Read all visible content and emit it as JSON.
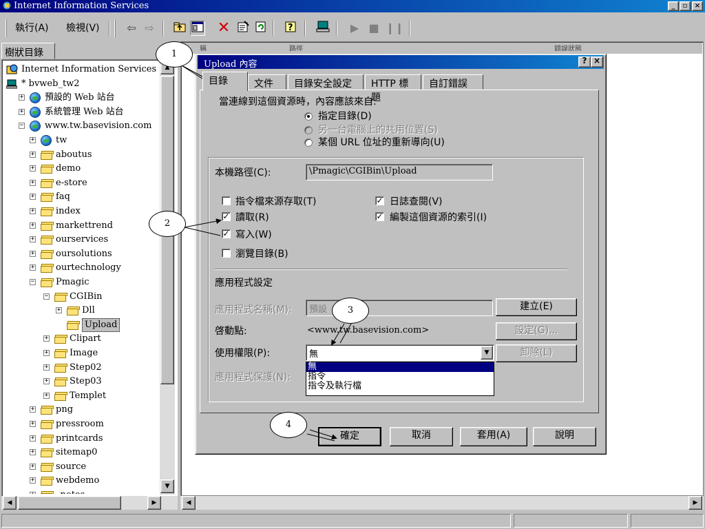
{
  "window": {
    "title": "Internet Information Services",
    "min": "_",
    "max": "▫",
    "close": "×"
  },
  "menu": {
    "action": "執行(A)",
    "view": "檢視(V)"
  },
  "toolbar_icons": [
    "back-icon",
    "forward-icon",
    "up-folder-icon",
    "show-hide-tree-icon",
    "delete-icon",
    "properties-icon",
    "refresh-icon",
    "help-icon",
    "computer-icon",
    "play-icon",
    "stop-icon",
    "pause-icon"
  ],
  "tree": {
    "tab_label": "樹狀目錄",
    "items": [
      {
        "label": "Internet Information Services",
        "icon": "iis-icon",
        "level": 0,
        "expander": ""
      },
      {
        "label": "* bvweb_tw2",
        "icon": "computer-icon",
        "level": 0,
        "expander": "−"
      },
      {
        "label": "預設的 Web 站台",
        "icon": "web-site-icon",
        "level": 1,
        "expander": "+"
      },
      {
        "label": "系統管理 Web 站台",
        "icon": "web-site-icon",
        "level": 1,
        "expander": "+"
      },
      {
        "label": "www.tw.basevision.com",
        "icon": "web-site-icon",
        "level": 1,
        "expander": "−"
      },
      {
        "label": "tw",
        "icon": "globe-icon",
        "level": 2,
        "expander": "+"
      },
      {
        "label": "aboutus",
        "icon": "folder-icon",
        "level": 2,
        "expander": "+"
      },
      {
        "label": "demo",
        "icon": "folder-icon",
        "level": 2,
        "expander": "+"
      },
      {
        "label": "e-store",
        "icon": "folder-icon",
        "level": 2,
        "expander": "+"
      },
      {
        "label": "faq",
        "icon": "folder-icon",
        "level": 2,
        "expander": "+"
      },
      {
        "label": "index",
        "icon": "folder-icon",
        "level": 2,
        "expander": "+"
      },
      {
        "label": "markettrend",
        "icon": "folder-icon",
        "level": 2,
        "expander": "+"
      },
      {
        "label": "ourservices",
        "icon": "folder-icon",
        "level": 2,
        "expander": "+"
      },
      {
        "label": "oursolutions",
        "icon": "folder-icon",
        "level": 2,
        "expander": "+"
      },
      {
        "label": "ourtechnology",
        "icon": "folder-icon",
        "level": 2,
        "expander": "+"
      },
      {
        "label": "Pmagic",
        "icon": "folder-icon",
        "level": 2,
        "expander": "−"
      },
      {
        "label": "CGIBin",
        "icon": "folder-icon",
        "level": 3,
        "expander": "−"
      },
      {
        "label": "Dll",
        "icon": "folder-icon",
        "level": 4,
        "expander": "+"
      },
      {
        "label": "Upload",
        "icon": "folder-icon",
        "level": 4,
        "expander": "",
        "selected": true
      },
      {
        "label": "Clipart",
        "icon": "folder-icon",
        "level": 3,
        "expander": "+"
      },
      {
        "label": "Image",
        "icon": "folder-icon",
        "level": 3,
        "expander": "+"
      },
      {
        "label": "Step02",
        "icon": "folder-icon",
        "level": 3,
        "expander": "+"
      },
      {
        "label": "Step03",
        "icon": "folder-icon",
        "level": 3,
        "expander": "+"
      },
      {
        "label": "Templet",
        "icon": "folder-icon",
        "level": 3,
        "expander": "+"
      },
      {
        "label": "png",
        "icon": "folder-icon",
        "level": 2,
        "expander": "+"
      },
      {
        "label": "pressroom",
        "icon": "folder-icon",
        "level": 2,
        "expander": "+"
      },
      {
        "label": "printcards",
        "icon": "folder-icon",
        "level": 2,
        "expander": "+"
      },
      {
        "label": "sitemap0",
        "icon": "folder-icon",
        "level": 2,
        "expander": "+"
      },
      {
        "label": "source",
        "icon": "folder-icon",
        "level": 2,
        "expander": "+"
      },
      {
        "label": "webdemo",
        "icon": "folder-icon",
        "level": 2,
        "expander": "+"
      },
      {
        "label": "_notes",
        "icon": "folder-icon",
        "level": 2,
        "expander": "+"
      }
    ]
  },
  "list_headers": [
    "稱",
    "路徑",
    "錯誤狀態"
  ],
  "dialog": {
    "title": "Upload 內容",
    "help_btn": "?",
    "close_btn": "×",
    "tabs": [
      "目錄",
      "文件",
      "目錄安全設定",
      "HTTP 標題",
      "自訂錯誤"
    ],
    "source_prompt": "當連線到這個資源時，內容應該來自:",
    "radios": [
      {
        "label": "指定目錄(D)",
        "checked": true,
        "disabled": false
      },
      {
        "label": "另一台電腦上的共用位置(S)",
        "checked": false,
        "disabled": true
      },
      {
        "label": "某個 URL 位址的重新導向(U)",
        "checked": false,
        "disabled": false
      }
    ],
    "local_path_label": "本機路徑(C):",
    "local_path_value": "\\Pmagic\\CGIBin\\Upload",
    "checkboxes_left": [
      {
        "label": "指令檔來源存取(T)",
        "checked": false
      },
      {
        "label": "讀取(R)",
        "checked": true
      },
      {
        "label": "寫入(W)",
        "checked": true
      },
      {
        "label": "瀏覽目錄(B)",
        "checked": false
      }
    ],
    "checkboxes_right": [
      {
        "label": "日誌查閱(V)",
        "checked": true
      },
      {
        "label": "編製這個資源的索引(I)",
        "checked": true
      }
    ],
    "app_settings_title": "應用程式設定",
    "app_name_label": "應用程式名稱(M):",
    "app_name_value": "預設",
    "create_btn": "建立(E)",
    "start_point_label": "啓動點:",
    "start_point_value": "<www.tw.basevision.com>",
    "config_btn": "設定(G)...",
    "permission_label": "使用權限(P):",
    "permission_value": "無",
    "unload_btn": "卸除(L)",
    "app_protection_label": "應用程式保護(N):",
    "permission_options": [
      "無",
      "指令",
      "指令及執行檔"
    ],
    "ok_btn": "確定",
    "cancel_btn": "取消",
    "apply_btn": "套用(A)",
    "help_footer_btn": "說明"
  },
  "callouts": [
    "1",
    "2",
    "3",
    "4"
  ]
}
